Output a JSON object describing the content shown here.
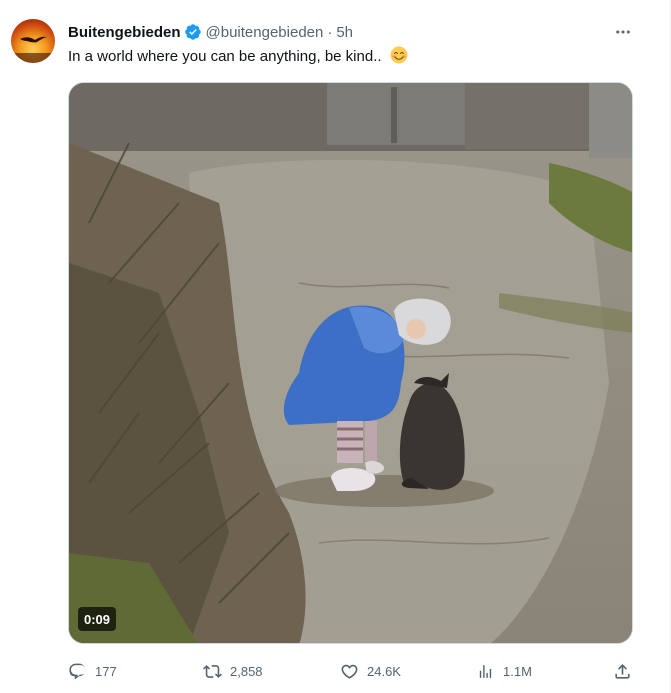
{
  "tweet": {
    "author_name": "Buitengebieden",
    "author_handle": "@buitengebieden",
    "separator": "·",
    "time": "5h",
    "text": "In a world where you can be anything, be kind..",
    "emoji": "smiling-face-with-smiling-eyes"
  },
  "media": {
    "type": "video",
    "duration": "0:09"
  },
  "actions": {
    "replies": "177",
    "retweets": "2,858",
    "likes": "24.6K",
    "views": "1.1M"
  },
  "icons": [
    "verified-badge-icon",
    "more-options-icon",
    "reply-icon",
    "retweet-icon",
    "like-icon",
    "views-icon",
    "share-icon"
  ],
  "colors": {
    "accent_blue": "#1d9bf0",
    "secondary_text": "#536471",
    "primary_text": "#0f1419"
  }
}
